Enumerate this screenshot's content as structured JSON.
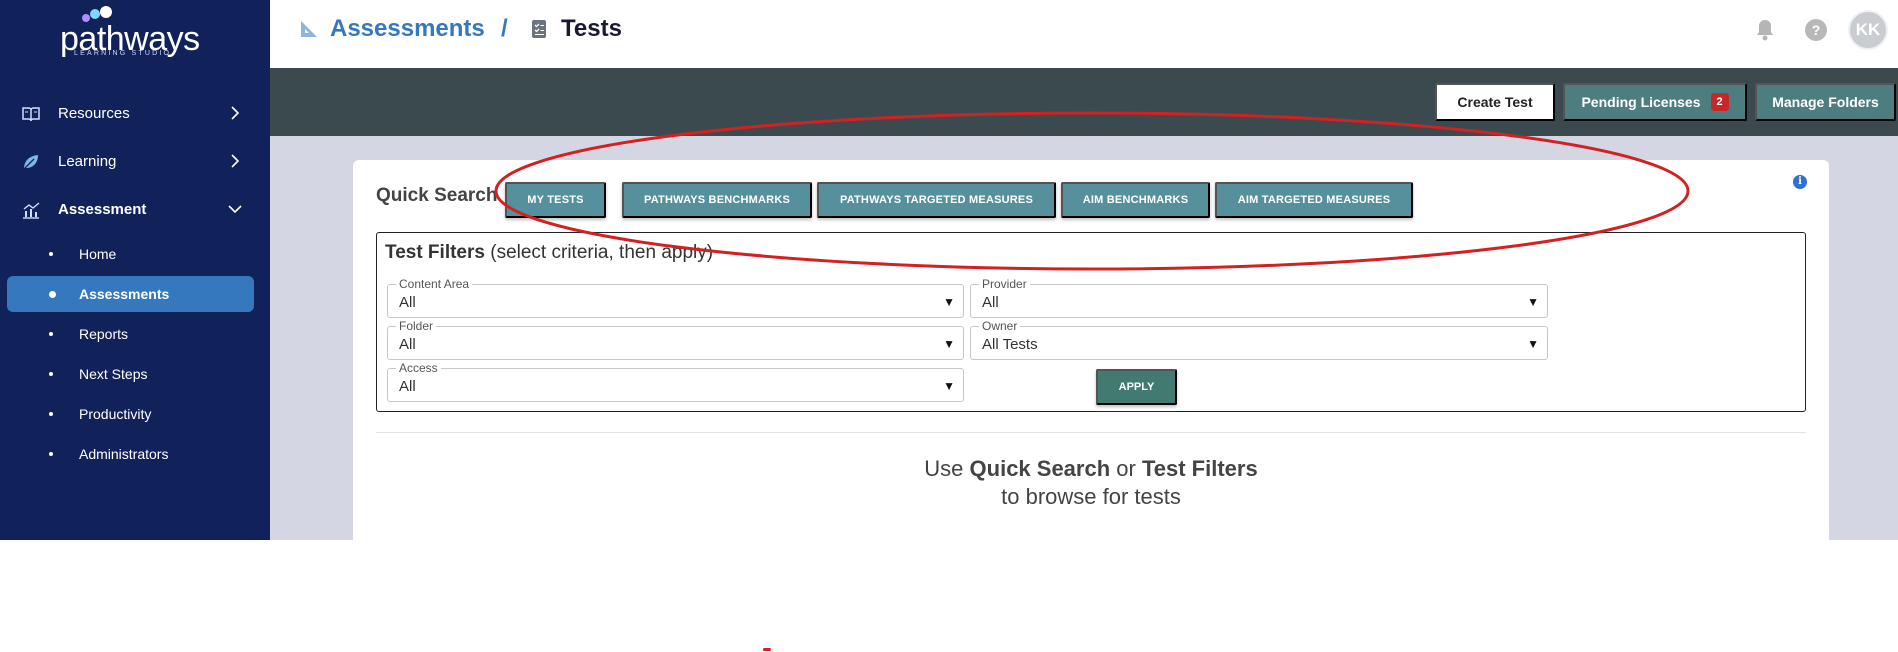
{
  "brand": {
    "logo_text": "pathways",
    "logo_sub": "LEARNING STUDIO"
  },
  "sidebar": {
    "items": [
      {
        "label": "Resources",
        "icon": "book-icon",
        "expanded": false
      },
      {
        "label": "Learning",
        "icon": "leaf-icon",
        "expanded": false
      },
      {
        "label": "Assessment",
        "icon": "chart-icon",
        "expanded": true
      }
    ],
    "sub_items": [
      {
        "label": "Home"
      },
      {
        "label": "Assessments",
        "active": true
      },
      {
        "label": "Reports"
      },
      {
        "label": "Next Steps"
      },
      {
        "label": "Productivity"
      },
      {
        "label": "Administrators"
      }
    ]
  },
  "header": {
    "breadcrumb_parent": "Assessments",
    "breadcrumb_sep": "/",
    "breadcrumb_current": "Tests",
    "help_glyph": "?",
    "avatar_initials": "KK"
  },
  "toolbar": {
    "create_label": "Create Test",
    "pending_label": "Pending Licenses",
    "pending_count": "2",
    "manage_label": "Manage Folders"
  },
  "quick_search": {
    "label": "Quick Search",
    "buttons": [
      "MY TESTS",
      "PATHWAYS BENCHMARKS",
      "PATHWAYS TARGETED MEASURES",
      "AIM BENCHMARKS",
      "AIM TARGETED MEASURES"
    ],
    "info_glyph": "i"
  },
  "filters": {
    "title_bold": "Test Filters",
    "title_rest": " (select criteria, then apply)",
    "content_area": {
      "label": "Content Area",
      "value": "All"
    },
    "provider": {
      "label": "Provider",
      "value": "All"
    },
    "folder": {
      "label": "Folder",
      "value": "All"
    },
    "owner": {
      "label": "Owner",
      "value": "All Tests"
    },
    "access": {
      "label": "Access",
      "value": "All"
    },
    "apply_label": "APPLY"
  },
  "browse": {
    "use": "Use ",
    "quick_search": "Quick Search",
    "or": " or ",
    "test_filters": "Test Filters",
    "line2": "to browse for tests"
  },
  "colors": {
    "sidebar_bg": "#11225a",
    "active_item": "#3578bd",
    "toolbar_bg": "#3a4a4f",
    "teal_button": "#56909c",
    "annotation": "#d32020"
  }
}
